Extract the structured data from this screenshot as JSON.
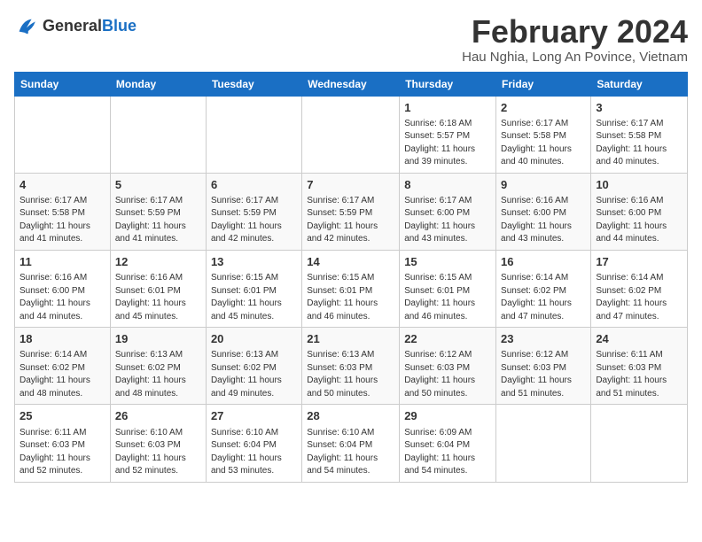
{
  "header": {
    "logo_general": "General",
    "logo_blue": "Blue",
    "title": "February 2024",
    "subtitle": "Hau Nghia, Long An Povince, Vietnam"
  },
  "weekdays": [
    "Sunday",
    "Monday",
    "Tuesday",
    "Wednesday",
    "Thursday",
    "Friday",
    "Saturday"
  ],
  "weeks": [
    [
      {
        "day": "",
        "info": ""
      },
      {
        "day": "",
        "info": ""
      },
      {
        "day": "",
        "info": ""
      },
      {
        "day": "",
        "info": ""
      },
      {
        "day": "1",
        "info": "Sunrise: 6:18 AM\nSunset: 5:57 PM\nDaylight: 11 hours\nand 39 minutes."
      },
      {
        "day": "2",
        "info": "Sunrise: 6:17 AM\nSunset: 5:58 PM\nDaylight: 11 hours\nand 40 minutes."
      },
      {
        "day": "3",
        "info": "Sunrise: 6:17 AM\nSunset: 5:58 PM\nDaylight: 11 hours\nand 40 minutes."
      }
    ],
    [
      {
        "day": "4",
        "info": "Sunrise: 6:17 AM\nSunset: 5:58 PM\nDaylight: 11 hours\nand 41 minutes."
      },
      {
        "day": "5",
        "info": "Sunrise: 6:17 AM\nSunset: 5:59 PM\nDaylight: 11 hours\nand 41 minutes."
      },
      {
        "day": "6",
        "info": "Sunrise: 6:17 AM\nSunset: 5:59 PM\nDaylight: 11 hours\nand 42 minutes."
      },
      {
        "day": "7",
        "info": "Sunrise: 6:17 AM\nSunset: 5:59 PM\nDaylight: 11 hours\nand 42 minutes."
      },
      {
        "day": "8",
        "info": "Sunrise: 6:17 AM\nSunset: 6:00 PM\nDaylight: 11 hours\nand 43 minutes."
      },
      {
        "day": "9",
        "info": "Sunrise: 6:16 AM\nSunset: 6:00 PM\nDaylight: 11 hours\nand 43 minutes."
      },
      {
        "day": "10",
        "info": "Sunrise: 6:16 AM\nSunset: 6:00 PM\nDaylight: 11 hours\nand 44 minutes."
      }
    ],
    [
      {
        "day": "11",
        "info": "Sunrise: 6:16 AM\nSunset: 6:00 PM\nDaylight: 11 hours\nand 44 minutes."
      },
      {
        "day": "12",
        "info": "Sunrise: 6:16 AM\nSunset: 6:01 PM\nDaylight: 11 hours\nand 45 minutes."
      },
      {
        "day": "13",
        "info": "Sunrise: 6:15 AM\nSunset: 6:01 PM\nDaylight: 11 hours\nand 45 minutes."
      },
      {
        "day": "14",
        "info": "Sunrise: 6:15 AM\nSunset: 6:01 PM\nDaylight: 11 hours\nand 46 minutes."
      },
      {
        "day": "15",
        "info": "Sunrise: 6:15 AM\nSunset: 6:01 PM\nDaylight: 11 hours\nand 46 minutes."
      },
      {
        "day": "16",
        "info": "Sunrise: 6:14 AM\nSunset: 6:02 PM\nDaylight: 11 hours\nand 47 minutes."
      },
      {
        "day": "17",
        "info": "Sunrise: 6:14 AM\nSunset: 6:02 PM\nDaylight: 11 hours\nand 47 minutes."
      }
    ],
    [
      {
        "day": "18",
        "info": "Sunrise: 6:14 AM\nSunset: 6:02 PM\nDaylight: 11 hours\nand 48 minutes."
      },
      {
        "day": "19",
        "info": "Sunrise: 6:13 AM\nSunset: 6:02 PM\nDaylight: 11 hours\nand 48 minutes."
      },
      {
        "day": "20",
        "info": "Sunrise: 6:13 AM\nSunset: 6:02 PM\nDaylight: 11 hours\nand 49 minutes."
      },
      {
        "day": "21",
        "info": "Sunrise: 6:13 AM\nSunset: 6:03 PM\nDaylight: 11 hours\nand 50 minutes."
      },
      {
        "day": "22",
        "info": "Sunrise: 6:12 AM\nSunset: 6:03 PM\nDaylight: 11 hours\nand 50 minutes."
      },
      {
        "day": "23",
        "info": "Sunrise: 6:12 AM\nSunset: 6:03 PM\nDaylight: 11 hours\nand 51 minutes."
      },
      {
        "day": "24",
        "info": "Sunrise: 6:11 AM\nSunset: 6:03 PM\nDaylight: 11 hours\nand 51 minutes."
      }
    ],
    [
      {
        "day": "25",
        "info": "Sunrise: 6:11 AM\nSunset: 6:03 PM\nDaylight: 11 hours\nand 52 minutes."
      },
      {
        "day": "26",
        "info": "Sunrise: 6:10 AM\nSunset: 6:03 PM\nDaylight: 11 hours\nand 52 minutes."
      },
      {
        "day": "27",
        "info": "Sunrise: 6:10 AM\nSunset: 6:04 PM\nDaylight: 11 hours\nand 53 minutes."
      },
      {
        "day": "28",
        "info": "Sunrise: 6:10 AM\nSunset: 6:04 PM\nDaylight: 11 hours\nand 54 minutes."
      },
      {
        "day": "29",
        "info": "Sunrise: 6:09 AM\nSunset: 6:04 PM\nDaylight: 11 hours\nand 54 minutes."
      },
      {
        "day": "",
        "info": ""
      },
      {
        "day": "",
        "info": ""
      }
    ]
  ]
}
